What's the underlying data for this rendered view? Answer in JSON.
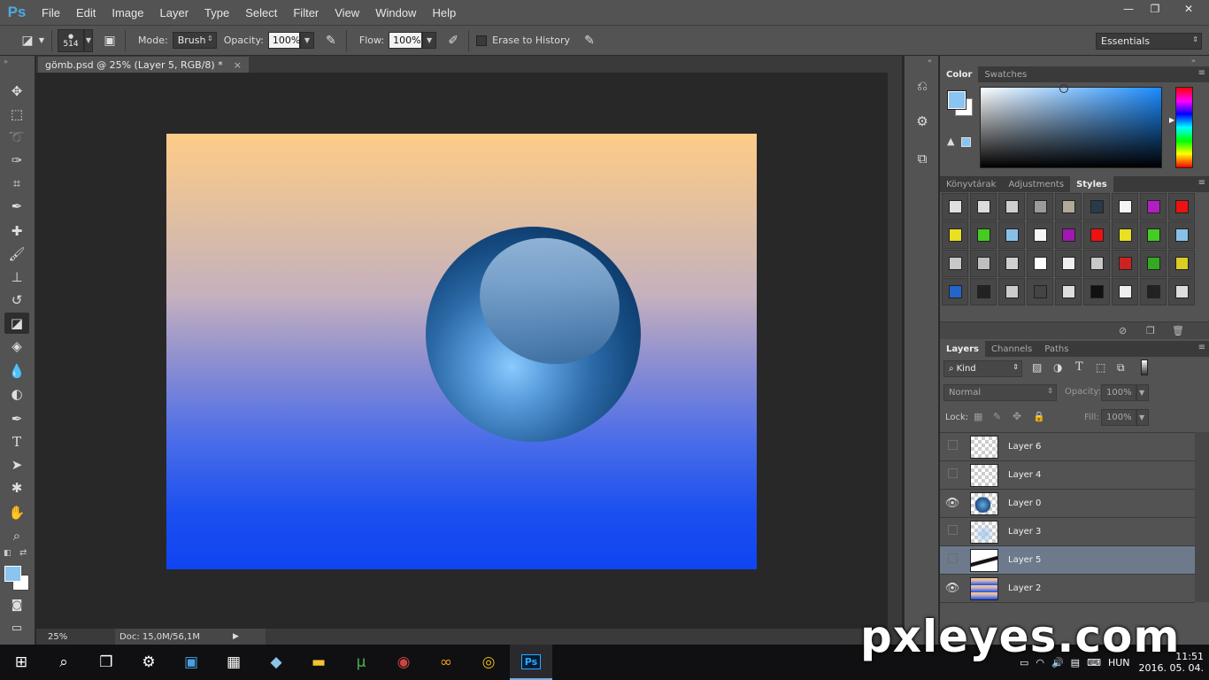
{
  "app": {
    "logo": "Ps"
  },
  "menu": [
    "File",
    "Edit",
    "Image",
    "Layer",
    "Type",
    "Select",
    "Filter",
    "View",
    "Window",
    "Help"
  ],
  "window_controls": {
    "minimize": "—",
    "restore": "❐",
    "close": "✕"
  },
  "options": {
    "brush_size": "514",
    "mode_label": "Mode:",
    "mode_value": "Brush",
    "opacity_label": "Opacity:",
    "opacity_value": "100%",
    "flow_label": "Flow:",
    "flow_value": "100%",
    "erase_history_label": "Erase to History",
    "workspace": "Essentials"
  },
  "document": {
    "tab_title": "gömb.psd @ 25% (Layer 5, RGB/8) *",
    "close": "×",
    "zoom": "25%",
    "doc_info": "Doc: 15,0M/56,1M"
  },
  "tools": [
    "move-tool",
    "marquee-tool",
    "lasso-tool",
    "quick-select-tool",
    "crop-tool",
    "eyedropper-tool",
    "healing-tool",
    "brush-tool",
    "stamp-tool",
    "history-brush-tool",
    "eraser-tool",
    "paint-bucket-tool",
    "blur-tool",
    "dodge-tool",
    "pen-tool",
    "type-tool",
    "path-select-tool",
    "shape-tool",
    "hand-tool",
    "zoom-tool"
  ],
  "panels": {
    "color_tabs": [
      "Color",
      "Swatches"
    ],
    "styles_tabs": [
      "Könyvtárak",
      "Adjustments",
      "Styles"
    ],
    "layers_tabs": [
      "Layers",
      "Channels",
      "Paths"
    ],
    "layers_filter": "Kind",
    "blend_mode": "Normal",
    "opacity_label": "Opacity:",
    "opacity_value": "100%",
    "lock_label": "Lock:",
    "fill_label": "Fill:",
    "fill_value": "100%"
  },
  "colors": {
    "foreground": "#8ac4f0",
    "background": "#ffffff",
    "selected_layer": "#6c7a8c"
  },
  "layers": [
    {
      "name": "Layer 6",
      "visible": false,
      "thumb": "transparent"
    },
    {
      "name": "Layer 4",
      "visible": false,
      "thumb": "transparent"
    },
    {
      "name": "Layer 0",
      "visible": true,
      "thumb": "sphere"
    },
    {
      "name": "Layer 3",
      "visible": false,
      "thumb": "light"
    },
    {
      "name": "Layer 5",
      "visible": false,
      "thumb": "stroke",
      "selected": true
    },
    {
      "name": "Layer 2",
      "visible": true,
      "thumb": "gradient"
    }
  ],
  "styles_swatches": [
    [
      "#e0e0e0",
      "#dcdcdc",
      "#cfcfcf",
      "#9a9a9a",
      "#b0a898",
      "#2a3a48",
      "#f4f4f4",
      "#b020c0",
      "#ee1111"
    ],
    [
      "#e8e020",
      "#44cc22",
      "#88c0e8",
      "#f6f6f6",
      "#a018b0",
      "#ee1111",
      "#e8e020",
      "#44cc22",
      "#88c0e8"
    ],
    [
      "#c8c8c8",
      "#bfbfbf",
      "#d0d0d0",
      "#ffffff",
      "#eeeeee",
      "#c8c8c8",
      "#cc2222",
      "#33aa22",
      "#ddcc22"
    ],
    [
      "#2266cc",
      "#222222",
      "#cccccc",
      "#444444",
      "#dddddd",
      "#111111",
      "#eeeeee",
      "#222222",
      "#dddddd"
    ]
  ],
  "taskbar": {
    "icons": [
      "windows-start",
      "search",
      "task-view",
      "settings",
      "explorer-app",
      "calculator",
      "store-app",
      "file-explorer",
      "utorrent",
      "media-app",
      "custom-app",
      "chrome",
      "photoshop"
    ],
    "language": "HUN",
    "time": "11:51",
    "date": "2016. 05. 04."
  },
  "watermark": "pxleyes.com"
}
